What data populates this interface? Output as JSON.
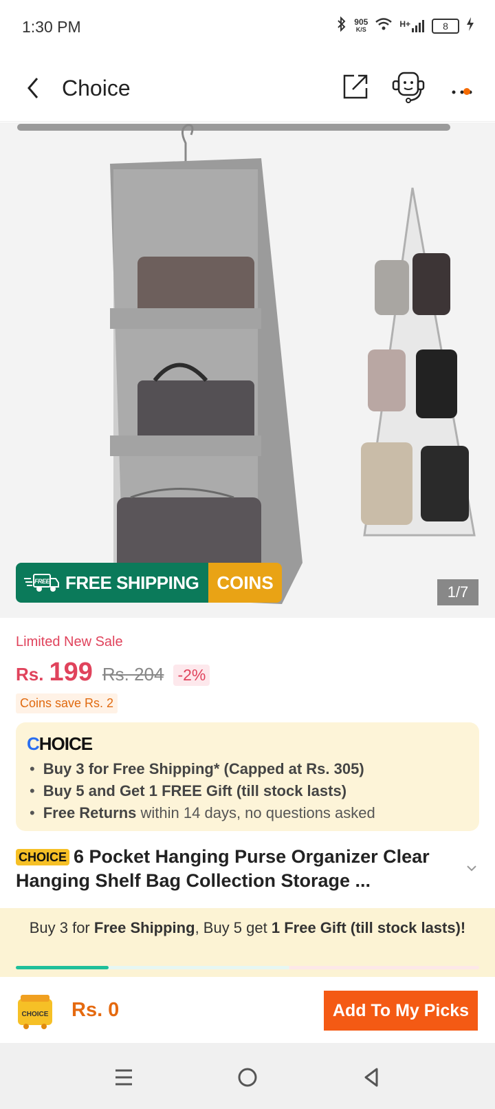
{
  "status_bar": {
    "time": "1:30 PM",
    "net_speed": "905",
    "net_unit": "K/S",
    "signal": "H+",
    "battery": "8"
  },
  "header": {
    "title": "Choice"
  },
  "gallery": {
    "counter": "1/7",
    "promo_free_badge": "FREE",
    "promo_free": "FREE SHIPPING",
    "promo_coins": "COINS"
  },
  "price": {
    "sale_label": "Limited New Sale",
    "currency": "Rs.",
    "current": "199",
    "original": "Rs. 204",
    "discount": "-2%",
    "coins_save": "Coins save Rs. 2"
  },
  "choice_box": {
    "logo": "CHOICE",
    "bullets": [
      {
        "bold": "Buy 3 for  Free Shipping* (Capped at Rs. 305)",
        "rest": ""
      },
      {
        "bold": "Buy 5 and Get 1 FREE Gift (till stock lasts)",
        "rest": ""
      },
      {
        "bold": "Free Returns",
        "rest": " within 14 days, no questions asked"
      }
    ]
  },
  "product": {
    "badge": "CHOICE",
    "title": "6 Pocket Hanging Purse Organizer Clear Hanging Shelf Bag Collection Storage ..."
  },
  "bundle": {
    "t1": "Buy 3 for ",
    "t2": "Free Shipping",
    "t3": ", Buy 5 get ",
    "t4": "1 Free Gift (till stock lasts)!",
    "progress": 0.2
  },
  "bottom": {
    "cart_label": "CHOICE",
    "total": "Rs. 0",
    "add_button": "Add To My Picks"
  },
  "colors": {
    "accent": "#f45a14",
    "price_red": "#e0435c",
    "choice_green": "#0b7a5a",
    "coins_yellow": "#e9a315"
  }
}
